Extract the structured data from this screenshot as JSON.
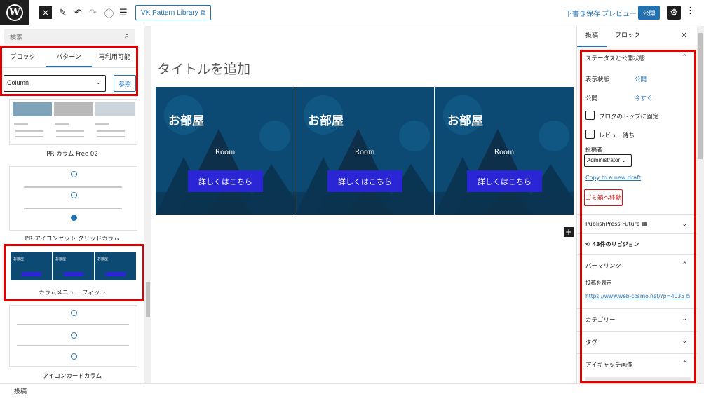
{
  "toolbar": {
    "close_icon": "×",
    "vk_label": "VK Pattern Library",
    "save_draft": "下書き保存",
    "preview": "プレビュー",
    "publish": "公開"
  },
  "inserter": {
    "search_placeholder": "検索",
    "tabs": [
      "ブロック",
      "パターン",
      "再利用可能"
    ],
    "category_value": "Column",
    "browse_label": "参照",
    "patterns": [
      {
        "label": "PR カラム Free 02"
      },
      {
        "label": "PR アイコンセット グリッドカラム"
      },
      {
        "label": "カラムメニュー フィット"
      },
      {
        "label": "アイコンカードカラム"
      }
    ]
  },
  "editor": {
    "title_placeholder": "タイトルを追加",
    "columns": [
      {
        "title": "お部屋",
        "subtitle": "Room",
        "button": "詳しくはこちら"
      },
      {
        "title": "お部屋",
        "subtitle": "Room",
        "button": "詳しくはこちら"
      },
      {
        "title": "お部屋",
        "subtitle": "Room",
        "button": "詳しくはこちら"
      }
    ]
  },
  "sidebar": {
    "tabs": [
      "投稿",
      "ブロック"
    ],
    "status_heading": "ステータスと公開状態",
    "visibility_label": "表示状態",
    "visibility_value": "公開",
    "publish_label": "公開",
    "publish_value": "今すぐ",
    "sticky_label": "ブログのトップに固定",
    "pending_label": "レビュー待ち",
    "author_label": "投稿者",
    "author_value": "Administrator",
    "copy_draft": "Copy to a new draft",
    "trash_label": "ゴミ箱へ移動",
    "publishpress_label": "PublishPress Future",
    "revisions_label": "43件のリビジョン",
    "permalink_heading": "パーマリンク",
    "view_post_label": "投稿を表示",
    "permalink_url": "https://www.web-cosmo.net/?p=4035",
    "categories_label": "カテゴリー",
    "tags_label": "タグ",
    "featured_image_label": "アイキャッチ画像"
  },
  "footer": {
    "breadcrumb": "投稿"
  },
  "colors": {
    "accent": "#2271b1",
    "highlight": "#e00000",
    "column_bg": "#0c4a73",
    "column_button": "#2a26d6"
  }
}
